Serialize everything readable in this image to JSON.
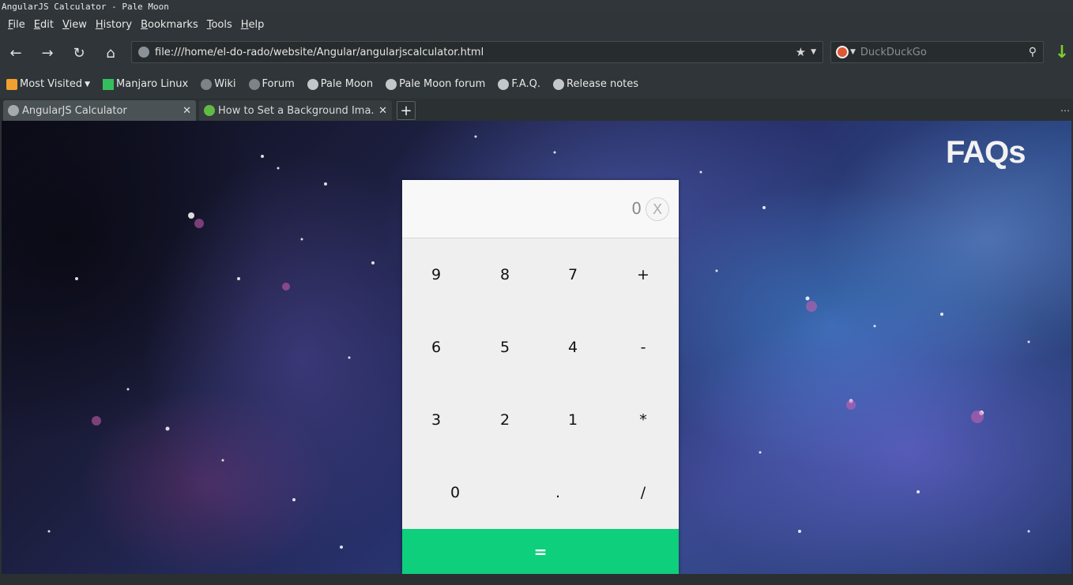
{
  "window": {
    "title": "AngularJS Calculator - Pale Moon"
  },
  "menu": [
    "File",
    "Edit",
    "View",
    "History",
    "Bookmarks",
    "Tools",
    "Help"
  ],
  "nav": {
    "url": "file:///home/el-do-rado/website/Angular/angularjscalculator.html",
    "search_placeholder": "DuckDuckGo"
  },
  "bookmarks": [
    {
      "label": "Most Visited",
      "icon": "folder-icon"
    },
    {
      "label": "Manjaro Linux",
      "icon": "manjaro-icon"
    },
    {
      "label": "Wiki",
      "icon": "globe-icon"
    },
    {
      "label": "Forum",
      "icon": "globe-icon"
    },
    {
      "label": "Pale Moon",
      "icon": "palemoon-icon"
    },
    {
      "label": "Pale Moon forum",
      "icon": "palemoon-icon"
    },
    {
      "label": "F.A.Q.",
      "icon": "palemoon-icon"
    },
    {
      "label": "Release notes",
      "icon": "palemoon-icon"
    }
  ],
  "tabs": [
    {
      "title": "AngularJS Calculator",
      "active": true
    },
    {
      "title": "How to Set a Background Ima...",
      "active": false
    }
  ],
  "page": {
    "watermark": "FAQs",
    "calculator": {
      "display": "0",
      "clear_label": "X",
      "keys": [
        [
          "9",
          "8",
          "7",
          "+"
        ],
        [
          "6",
          "5",
          "4",
          "-"
        ],
        [
          "3",
          "2",
          "1",
          "*"
        ],
        [
          "0",
          ".",
          "/"
        ]
      ],
      "equals_label": "="
    }
  },
  "colors": {
    "equals_bg": "#0ecf7c",
    "keypad_bg": "#efefef"
  }
}
